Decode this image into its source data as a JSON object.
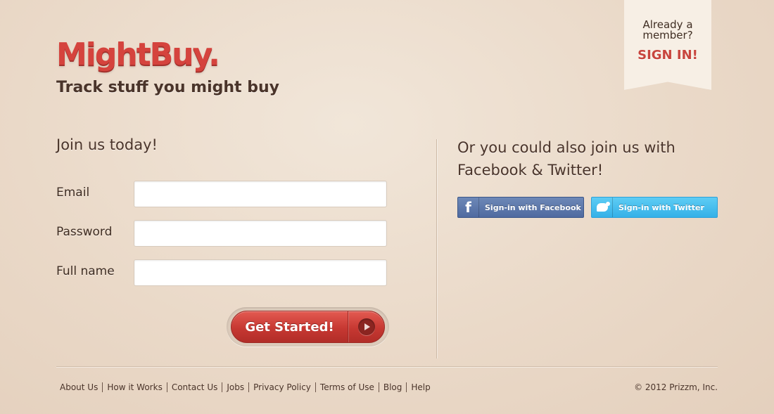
{
  "header": {
    "logo": "MightBuy.",
    "tagline": "Track stuff you might buy"
  },
  "signin_ribbon": {
    "line1": "Already a",
    "line2": "member?",
    "link": "SIGN IN!"
  },
  "signup": {
    "title": "Join us today!",
    "fields": [
      {
        "label": "Email",
        "value": "",
        "placeholder": ""
      },
      {
        "label": "Password",
        "value": "",
        "placeholder": ""
      },
      {
        "label": "Full name",
        "value": "",
        "placeholder": ""
      }
    ],
    "submit_label": "Get Started!"
  },
  "social": {
    "title": "Or you could also join us with Facebook & Twitter!",
    "facebook_label": "Sign-in with Facebook",
    "facebook_icon": "f",
    "twitter_label": "Sign-in with Twitter"
  },
  "footer": {
    "links": [
      "About Us",
      "How it Works",
      "Contact Us",
      "Jobs",
      "Privacy Policy",
      "Terms of Use",
      "Blog",
      "Help"
    ],
    "copyright": "© 2012 Prizzm, Inc."
  },
  "colors": {
    "brand": "#d5433d",
    "facebook": "#4f6aa0",
    "twitter": "#34b1e8",
    "background": "#ead9c8"
  }
}
